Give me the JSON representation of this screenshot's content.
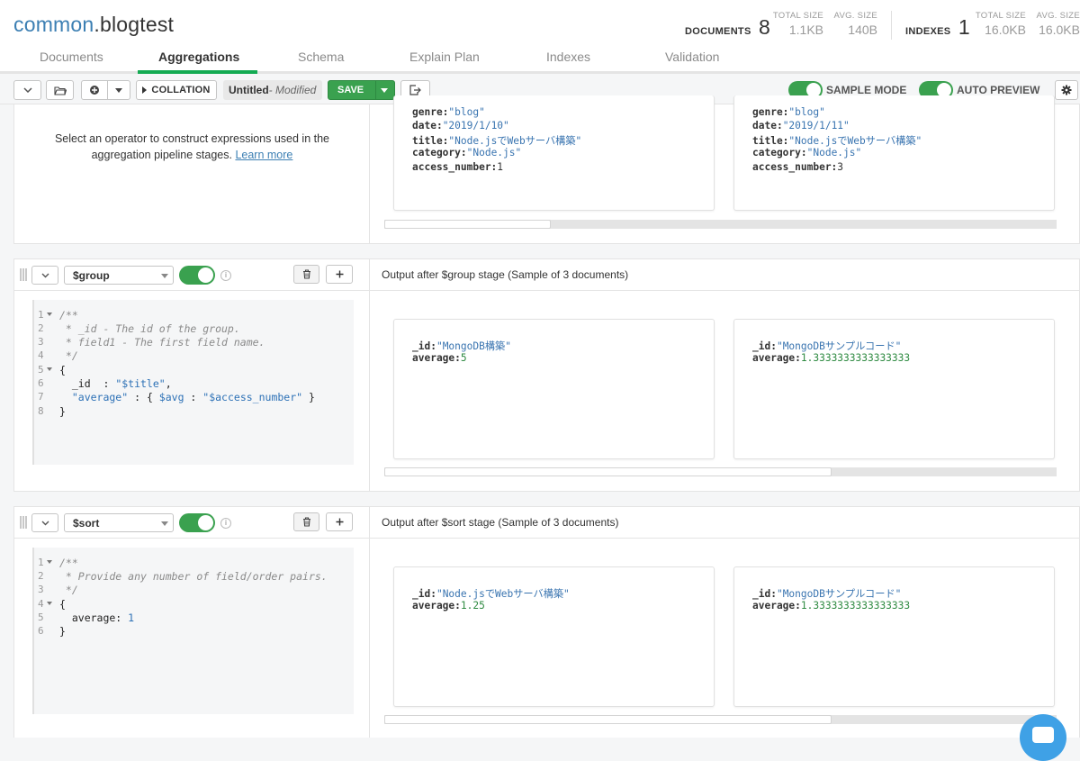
{
  "header": {
    "db": "common",
    "collection": ".blogtest",
    "documents_label": "DOCUMENTS",
    "documents_count": "8",
    "total_size_label": "TOTAL SIZE",
    "total_size": "1.1KB",
    "avg_size_label": "AVG. SIZE",
    "avg_size": "140B",
    "indexes_label": "INDEXES",
    "indexes_count": "1",
    "idx_total_size_label": "TOTAL SIZE",
    "idx_total_size": "16.0KB",
    "idx_avg_size_label": "AVG. SIZE",
    "idx_avg_size": "16.0KB"
  },
  "tabs": [
    {
      "label": "Documents"
    },
    {
      "label": "Aggregations"
    },
    {
      "label": "Schema"
    },
    {
      "label": "Explain Plan"
    },
    {
      "label": "Indexes"
    },
    {
      "label": "Validation"
    }
  ],
  "toolbar": {
    "collation_label": "COLLATION",
    "pipeline_name": "Untitled",
    "pipeline_status": "- Modified",
    "save_label": "SAVE",
    "sample_mode_label": "SAMPLE MODE",
    "auto_preview_label": "AUTO PREVIEW"
  },
  "stage0": {
    "help_text": "Select an operator to construct expressions used in the aggregation pipeline stages.",
    "learn_more": "Learn more",
    "docs": [
      {
        "genre": "\"blog\"",
        "date": "\"2019/1/10\"",
        "title": "\"Node.jsでWebサーバ構築\"",
        "category": "\"Node.js\"",
        "access_number": "1"
      },
      {
        "genre": "\"blog\"",
        "date": "\"2019/1/11\"",
        "title": "\"Node.jsでWebサーバ構築\"",
        "category": "\"Node.js\"",
        "access_number": "3"
      }
    ],
    "keys": {
      "genre": "genre:",
      "date": "date:",
      "title": "title:",
      "category": "category:",
      "access_number": "access_number:"
    }
  },
  "stage1": {
    "operator": "$group",
    "output_title": "Output after $group stage (Sample of 3 documents)",
    "code": {
      "l1": "/**",
      "l2": " * _id - The id of the group.",
      "l3": " * field1 - The first field name.",
      "l4": " */",
      "l5": "{",
      "l6a": "  _id  : ",
      "l6b": "\"$title\"",
      "l6c": ",",
      "l7a": "  \"average\"",
      "l7b": " : { ",
      "l7c": "$avg",
      "l7d": " : ",
      "l7e": "\"$access_number\"",
      "l7f": " }",
      "l8": "}"
    },
    "docs": [
      {
        "id": "\"MongoDB構築\"",
        "average": "5"
      },
      {
        "id": "\"MongoDBサンプルコード\"",
        "average": "1.3333333333333333"
      }
    ]
  },
  "stage2": {
    "operator": "$sort",
    "output_title": "Output after $sort stage (Sample of 3 documents)",
    "code": {
      "l1": "/**",
      "l2": " * Provide any number of field/order pairs.",
      "l3": " */",
      "l4": "{",
      "l5a": "  average: ",
      "l5b": "1",
      "l6": "}"
    },
    "docs": [
      {
        "id": "\"Node.jsでWebサーバ構築\"",
        "average": "1.25"
      },
      {
        "id": "\"MongoDBサンプルコード\"",
        "average": "1.3333333333333333"
      }
    ]
  },
  "labels": {
    "id_key": "_id:",
    "average_key": "average:"
  },
  "colors": {
    "accent_green": "#13aa52",
    "toggle_green": "#3aa14f",
    "string_blue": "#3974b0"
  }
}
